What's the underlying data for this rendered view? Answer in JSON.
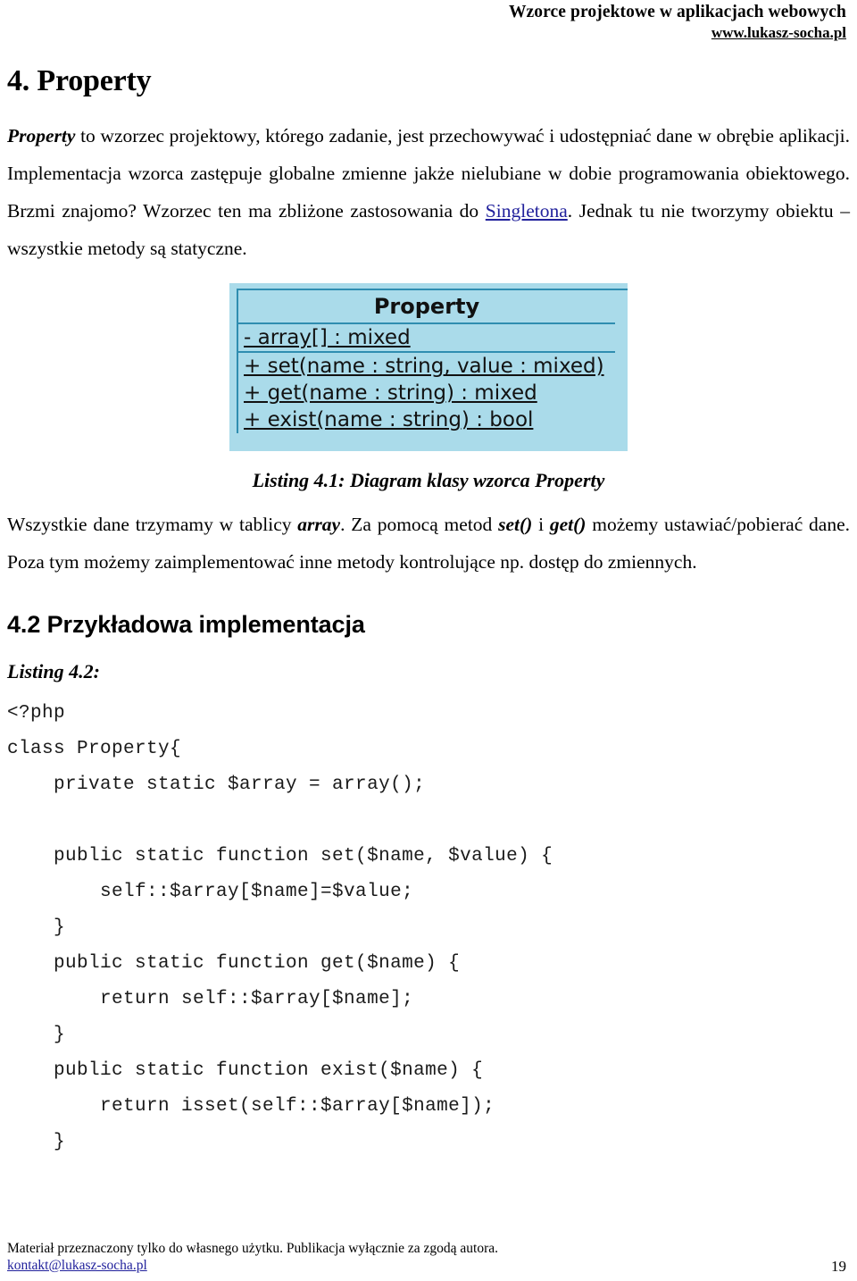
{
  "header": {
    "title": "Wzorce projektowe w aplikacjach webowych",
    "url": "www.lukasz-socha.pl"
  },
  "chapter": {
    "title": "4. Property"
  },
  "intro": {
    "p1_lead": "Property",
    "p1_rest": " to wzorzec projektowy, którego zadanie, jest przechowywać i udostępniać dane w obrębie aplikacji. Implementacja wzorca zastępuje globalne zmienne jakże nielubiane w dobie programowania obiektowego. Brzmi znajomo? Wzorzec ten ma zbliżone zastosowania do ",
    "link_text": "Singletona",
    "p1_tail": ". Jednak tu nie tworzymy obiektu – wszystkie metody są statyczne."
  },
  "uml": {
    "class_name": "Property",
    "attributes": [
      "- array[] : mixed"
    ],
    "methods": [
      "+ set(name : string, value : mixed)",
      "+ get(name : string) : mixed",
      "+ exist(name : string) : bool"
    ],
    "fill_color": "#aadbea",
    "line_color": "#2f8db0"
  },
  "caption": {
    "figure": "Listing 4.1: Diagram klasy wzorca Property"
  },
  "explanation": {
    "t1": "Wszystkie dane trzymamy w tablicy ",
    "b1": "array",
    "t2": ". Za pomocą metod ",
    "b2": "set()",
    "t3": " i ",
    "b3": "get()",
    "t4": " możemy ustawiać/pobierać dane. Poza tym możemy zaimplementować inne metody kontrolujące np. dostęp do zmiennych."
  },
  "section": {
    "title": "4.2 Przykładowa implementacja",
    "listing_label": "Listing 4.2:"
  },
  "code": {
    "language": "php",
    "text": "<?php\nclass Property{\n    private static $array = array();\n\n    public static function set($name, $value) {\n        self::$array[$name]=$value;\n    }\n    public static function get($name) {\n        return self::$array[$name];\n    }\n    public static function exist($name) {\n        return isset(self::$array[$name]);\n    }"
  },
  "footer": {
    "note": "Materiał przeznaczony tylko do własnego użytku. Publikacja wyłącznie za zgodą autora.",
    "email": "kontakt@lukasz-socha.pl",
    "page_number": "19",
    "link_color": "#21219c"
  }
}
